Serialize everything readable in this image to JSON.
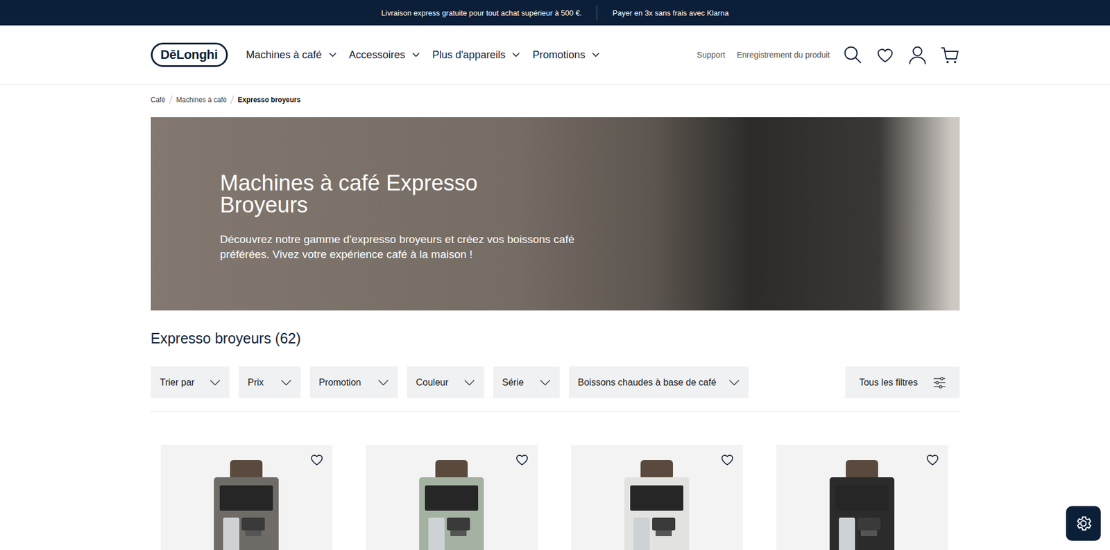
{
  "promo_bar": {
    "items": [
      "Livraison express gratuite pour tout achat supérieur à 500 €.",
      "Payer en 3x sans frais avec Klarna"
    ]
  },
  "header": {
    "logo": "DēLonghi",
    "nav": [
      {
        "label": "Machines à café"
      },
      {
        "label": "Accessoires"
      },
      {
        "label": "Plus d'appareils"
      },
      {
        "label": "Promotions"
      }
    ],
    "links": [
      "Support",
      "Enregistrement du produit"
    ]
  },
  "breadcrumb": [
    {
      "label": "Café",
      "current": false
    },
    {
      "label": "Machines à café",
      "current": false
    },
    {
      "label": "Expresso broyeurs",
      "current": true
    }
  ],
  "banner": {
    "title": "Machines à café Expresso Broyeurs",
    "description": "Découvrez notre gamme d'expresso broyeurs et créez vos boissons café préférées. Vivez votre expérience café à la maison !"
  },
  "listing": {
    "heading": "Expresso broyeurs (62)",
    "filters": [
      "Trier par",
      "Prix",
      "Promotion",
      "Couleur",
      "Série",
      "Boissons chaudes à base de café"
    ],
    "all_filters": "Tous les filtres"
  },
  "products": [
    {
      "color": "#6f6b67",
      "favorite": false
    },
    {
      "color": "#a4b2a1",
      "favorite": false
    },
    {
      "color": "#e2e2e0",
      "favorite": false
    },
    {
      "color": "#2b2b2b",
      "favorite": false
    }
  ]
}
